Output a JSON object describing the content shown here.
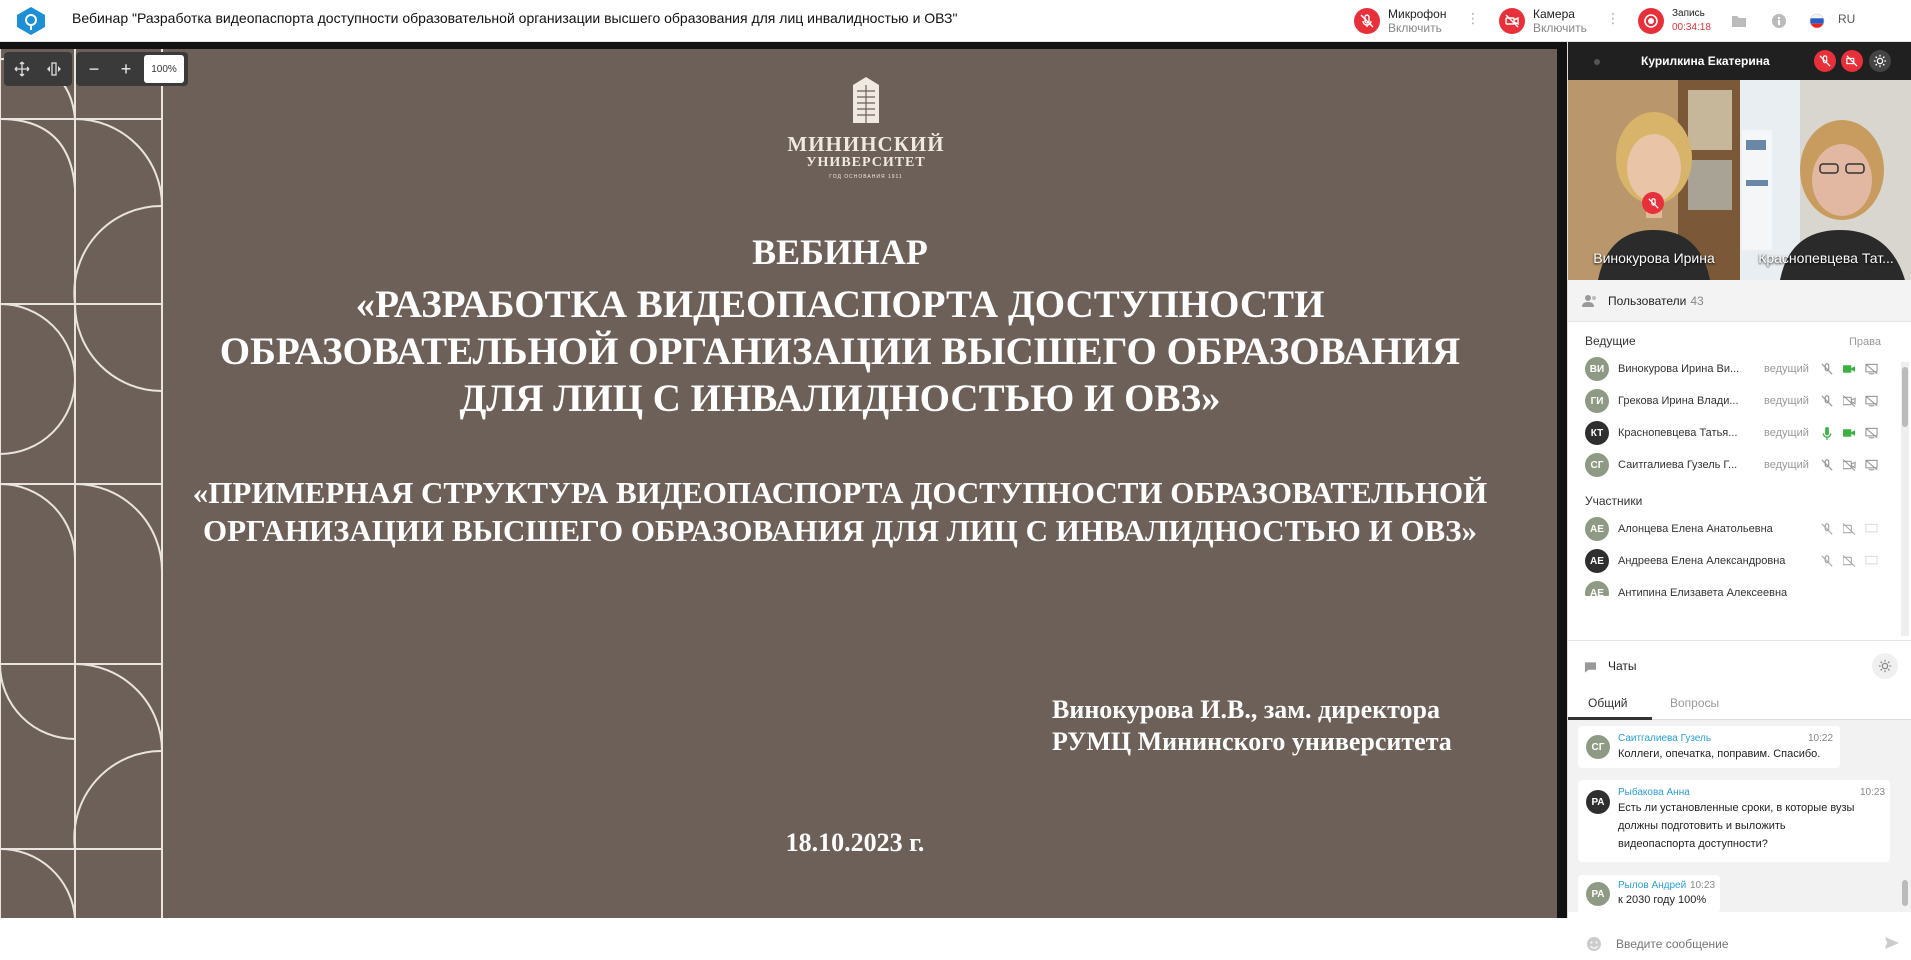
{
  "header": {
    "title": "Вебинар \"Разработка видеопаспорта доступности образовательной организации высшего образования для лиц инвалидностью и ОВЗ\"",
    "mic_label": "Микрофон",
    "mic_action": "Включить",
    "cam_label": "Камера",
    "cam_action": "Включить",
    "rec_label": "Запись",
    "rec_time": "00:34:18",
    "lang": "RU"
  },
  "viewer": {
    "zoom": "100%",
    "slide": {
      "logo_line1": "МИНИНСКИЙ",
      "logo_line2": "УНИВЕРСИТЕТ",
      "logo_line3": "ГОД ОСНОВАНИЯ 1911",
      "heading1": "ВЕБИНАР",
      "heading2": "«РАЗРАБОТКА ВИДЕОПАСПОРТА ДОСТУПНОСТИ ОБРАЗОВАТЕЛЬНОЙ ОРГАНИЗАЦИИ ВЫСШЕГО ОБРАЗОВАНИЯ ДЛЯ ЛИЦ С ИНВАЛИДНОСТЬЮ И ОВЗ»",
      "subheading": "«ПРИМЕРНАЯ СТРУКТУРА ВИДЕОПАСПОРТА ДОСТУПНОСТИ ОБРАЗОВАТЕЛЬНОЙ ОРГАНИЗАЦИИ ВЫСШЕГО ОБРАЗОВАНИЯ ДЛЯ ЛИЦ С ИНВАЛИДНОСТЬЮ И ОВЗ»",
      "author_line1": "Винокурова И.В., зам. директора",
      "author_line2": "РУМЦ Мининского университета",
      "date": "18.10.2023 г."
    }
  },
  "panel": {
    "host_name": "Курилкина Екатерина",
    "tiles": [
      {
        "name": "Винокурова Ирина"
      },
      {
        "name": "Краснопевцева Тат..."
      }
    ],
    "users": {
      "title": "Пользователи",
      "count": "43",
      "hosts_label": "Ведущие",
      "rights_label": "Права",
      "participants_label": "Участники",
      "hosts": [
        {
          "initials": "ВИ",
          "name": "Винокурова Ирина Ви...",
          "role": "ведущий",
          "mic": "off",
          "cam": "on"
        },
        {
          "initials": "ГИ",
          "name": "Грекова Ирина Влади...",
          "role": "ведущий",
          "mic": "off",
          "cam": "off"
        },
        {
          "initials": "КТ",
          "name": "Краснопевцева Татья...",
          "role": "ведущий",
          "mic": "on",
          "cam": "on"
        },
        {
          "initials": "СГ",
          "name": "Саитгалиева Гузель Г...",
          "role": "ведущий",
          "mic": "off",
          "cam": "off"
        }
      ],
      "participants": [
        {
          "initials": "АЕ",
          "name": "Алонцева Елена Анатольевна"
        },
        {
          "initials": "АЕ",
          "name": "Андреева Елена Александровна"
        },
        {
          "initials": "АЕ",
          "name": "Антипина Елизавета Алексеевна"
        }
      ]
    },
    "chats": {
      "title": "Чаты",
      "tab_general": "Общий",
      "tab_questions": "Вопросы",
      "messages": [
        {
          "initials": "СГ",
          "author": "Саитгалиева Гузель",
          "time": "10:22",
          "text": "Коллеги, опечатка, поправим. Спасибо."
        },
        {
          "initials": "РА",
          "author": "Рыбакова Анна",
          "time": "10:23",
          "text1": "Есть ли установленные сроки, в которые вузы",
          "text2": "должны подготовить и выложить",
          "text3": "видеопаспорта доступности?"
        },
        {
          "initials": "РА",
          "author": "Рылов Андрей",
          "time": "10:23",
          "text": "к 2030 году 100%"
        }
      ],
      "input_placeholder": "Введите сообщение"
    }
  },
  "colors": {
    "accent_red": "#e8303a",
    "slide_bg": "#6d6058",
    "link_blue": "#2a9fd6"
  }
}
